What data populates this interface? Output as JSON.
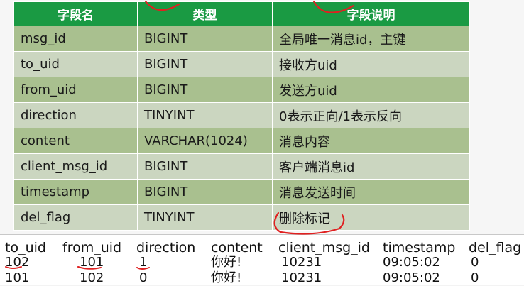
{
  "schema_table": {
    "headers": [
      "字段名",
      "类型",
      "字段说明"
    ],
    "rows": [
      [
        "msg_id",
        "BIGINT",
        "全局唯一消息id，主键"
      ],
      [
        "to_uid",
        "BIGINT",
        "接收方uid"
      ],
      [
        "from_uid",
        "BIGINT",
        "发送方uid"
      ],
      [
        "direction",
        "TINYINT",
        "0表示正向/1表示反向"
      ],
      [
        "content",
        "VARCHAR(1024)",
        "消息内容"
      ],
      [
        "client_msg_id",
        "BIGINT",
        "客户端消息id"
      ],
      [
        "timestamp",
        "BIGINT",
        "消息发送时间"
      ],
      [
        "del_flag",
        "TINYINT",
        "删除标记"
      ]
    ]
  },
  "example_table": {
    "headers": [
      "to_uid",
      "from_uid",
      "direction",
      "content",
      "client_msg_id",
      "timestamp",
      "del_flag"
    ],
    "rows": [
      [
        "102",
        "101",
        "1",
        "你好!",
        "10231",
        "09:05:02",
        "0"
      ],
      [
        "101",
        "102",
        "0",
        "你好!",
        "10231",
        "09:05:02",
        "0"
      ]
    ]
  },
  "colors": {
    "header_green": "#1a9a43",
    "row_dark": "#a9c08f",
    "row_light": "#cbd6c0",
    "annotation_red": "#e02020"
  }
}
